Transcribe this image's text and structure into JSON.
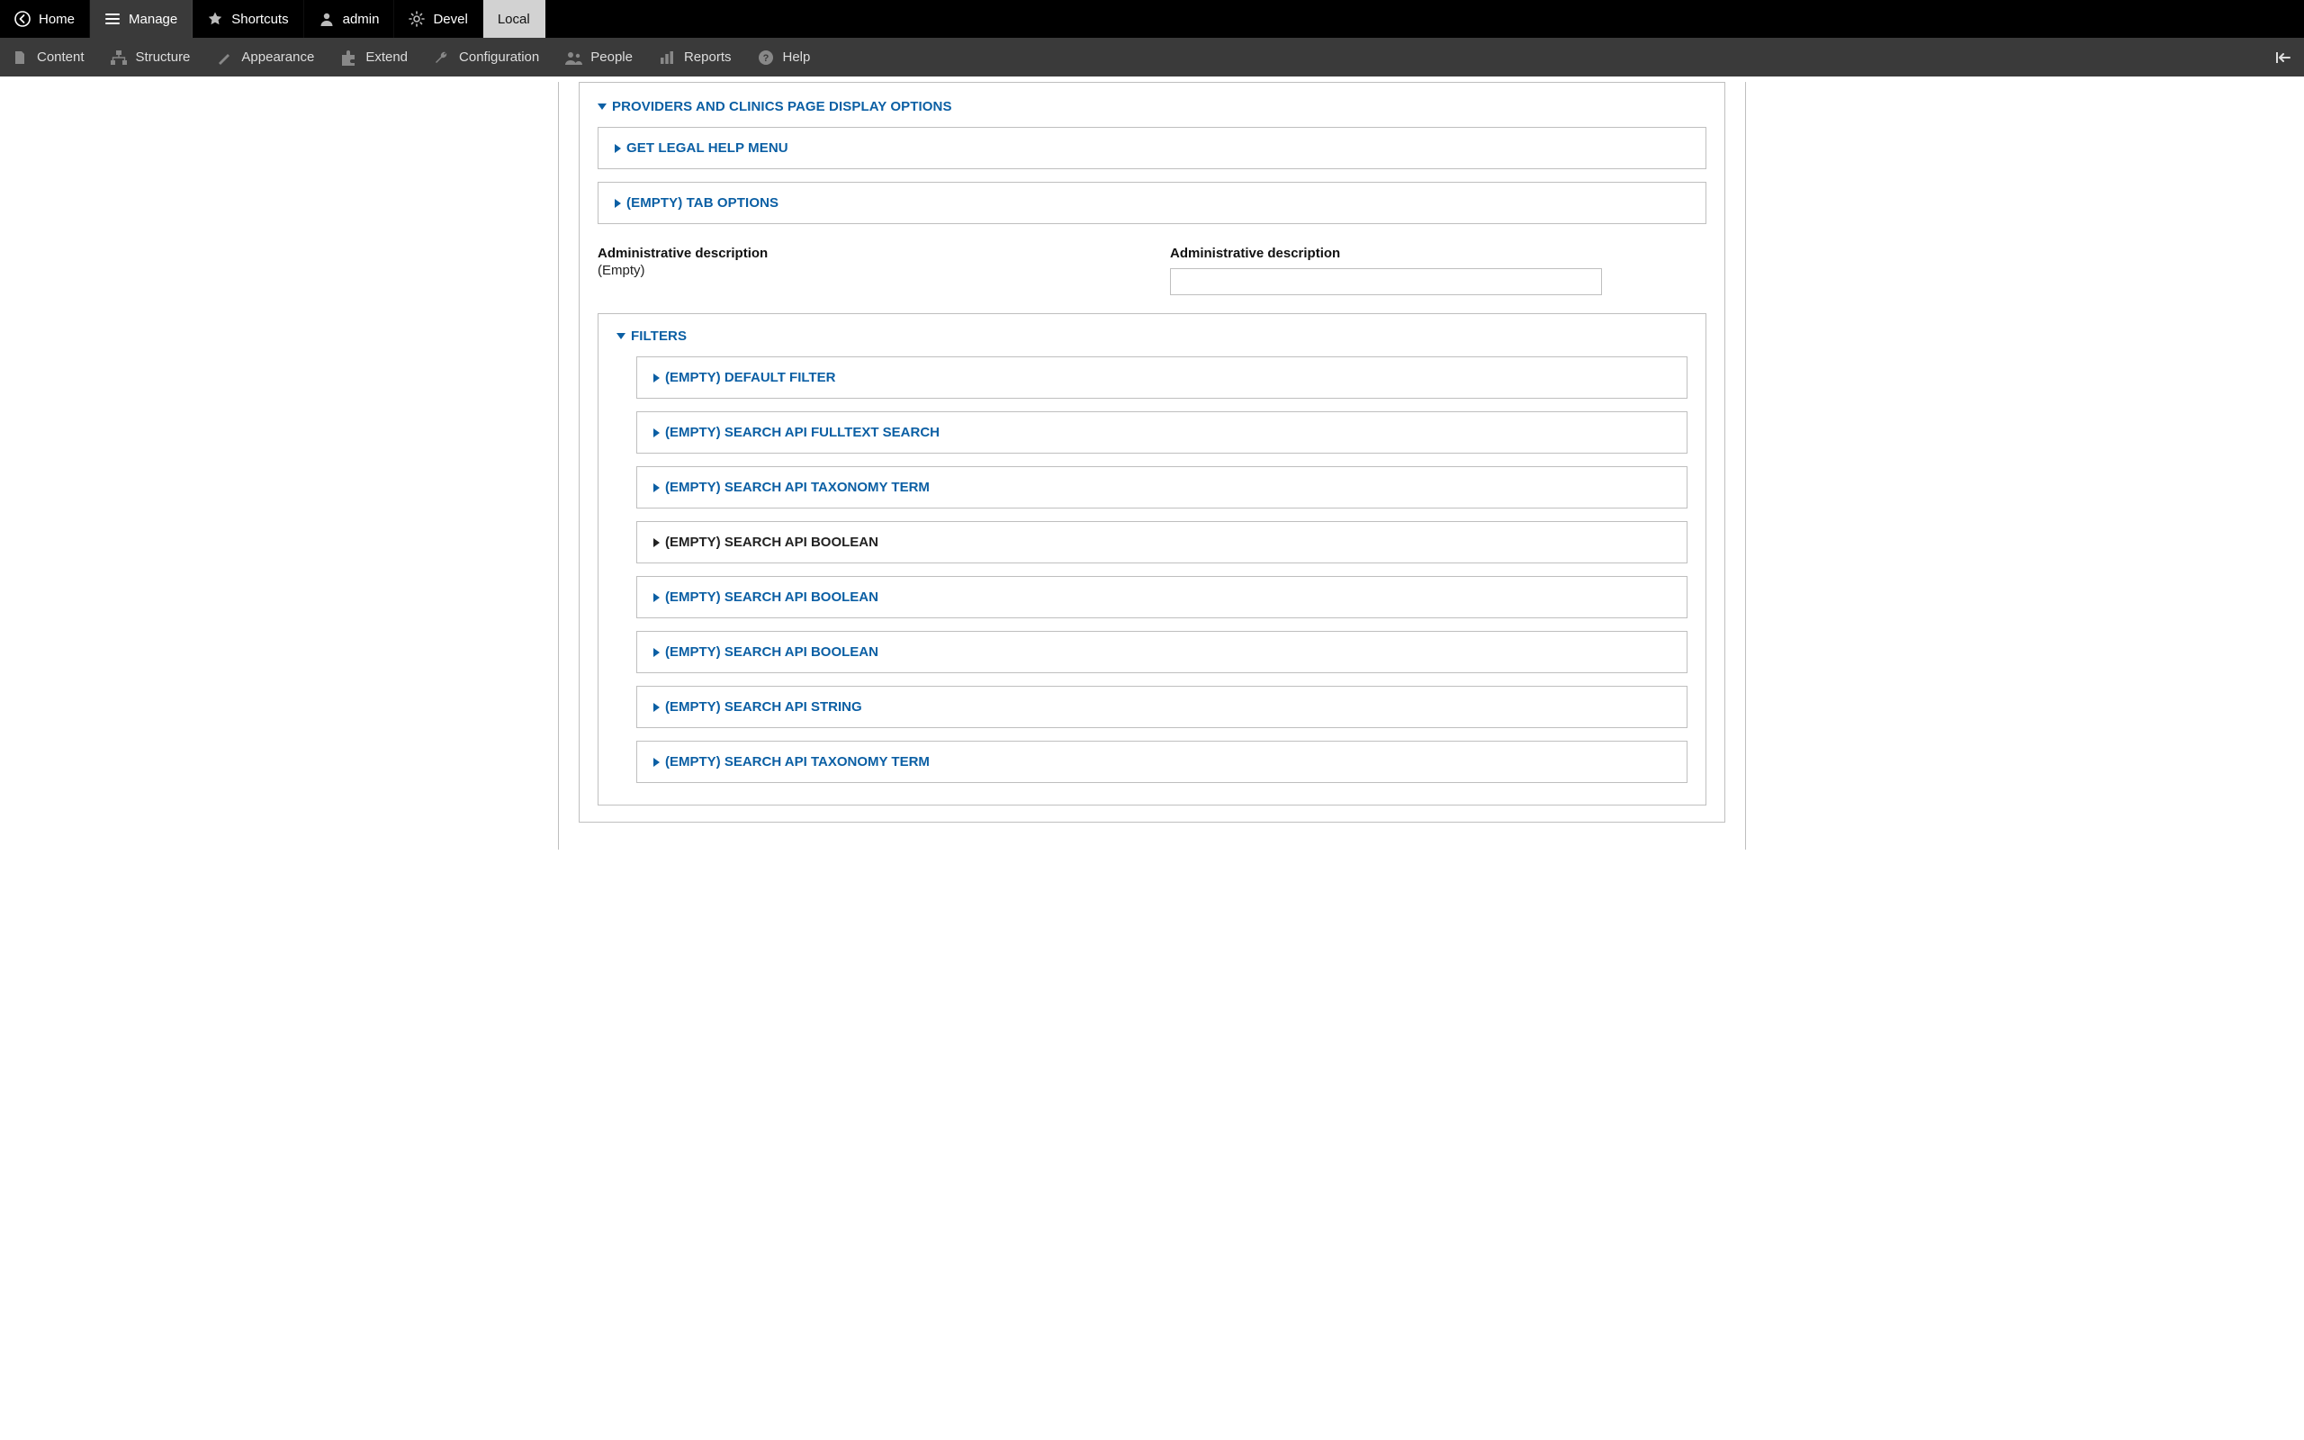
{
  "toolbar_top": {
    "home": "Home",
    "manage": "Manage",
    "shortcuts": "Shortcuts",
    "admin": "admin",
    "devel": "Devel",
    "local": "Local"
  },
  "toolbar_admin": {
    "content": "Content",
    "structure": "Structure",
    "appearance": "Appearance",
    "extend": "Extend",
    "configuration": "Configuration",
    "people": "People",
    "reports": "Reports",
    "help": "Help"
  },
  "main": {
    "display_options_title": "PROVIDERS AND CLINICS PAGE DISPLAY OPTIONS",
    "get_legal_help_menu": "GET LEGAL HELP MENU",
    "empty_tab_options": "(EMPTY) TAB OPTIONS",
    "admin_desc_left_label": "Administrative description",
    "admin_desc_left_value": "(Empty)",
    "admin_desc_right_label": "Administrative description",
    "admin_desc_right_value": "",
    "filters_title": "FILTERS",
    "filters": [
      {
        "label": "(EMPTY) DEFAULT FILTER",
        "color": "blue"
      },
      {
        "label": "(EMPTY) SEARCH API FULLTEXT SEARCH",
        "color": "blue"
      },
      {
        "label": "(EMPTY) SEARCH API TAXONOMY TERM",
        "color": "blue"
      },
      {
        "label": "(EMPTY) SEARCH API BOOLEAN",
        "color": "black"
      },
      {
        "label": "(EMPTY) SEARCH API BOOLEAN",
        "color": "blue"
      },
      {
        "label": "(EMPTY) SEARCH API BOOLEAN",
        "color": "blue"
      },
      {
        "label": "(EMPTY) SEARCH API STRING",
        "color": "blue"
      },
      {
        "label": "(EMPTY) SEARCH API TAXONOMY TERM",
        "color": "blue"
      }
    ]
  }
}
